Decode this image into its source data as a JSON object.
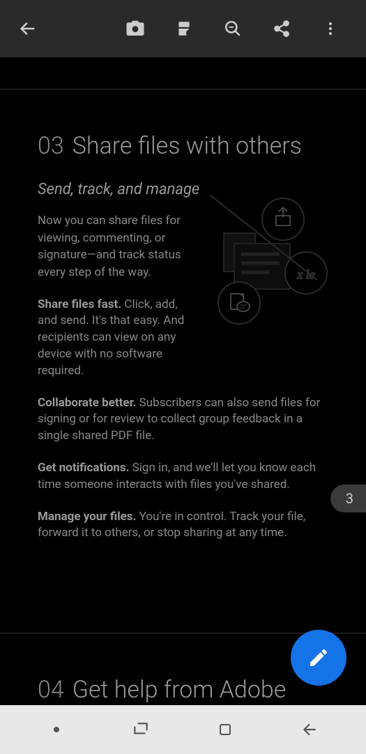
{
  "section1": {
    "num": "03",
    "title": "Share files with others",
    "subtitle": "Send, track, and manage",
    "intro": "Now you can share files for viewing, commenting, or signature—and track status every step of the way.",
    "bullets": [
      {
        "bold": "Share files fast.",
        "text": " Click, add, and send. It's that easy. And recipients can view on any device with no software required."
      },
      {
        "bold": "Collaborate better.",
        "text": " Subscribers can also send files for signing or for review to collect group feedback in a single shared PDF file."
      },
      {
        "bold": "Get notifications.",
        "text": " Sign in, and we'll let you know each time someone interacts with files you've shared."
      },
      {
        "bold": "Manage your files.",
        "text": " You're in control. Track your file, forward it to others, or stop sharing at any time."
      }
    ]
  },
  "section2": {
    "num": "04",
    "title": "Get help from Adobe"
  },
  "pageIndicator": "3"
}
